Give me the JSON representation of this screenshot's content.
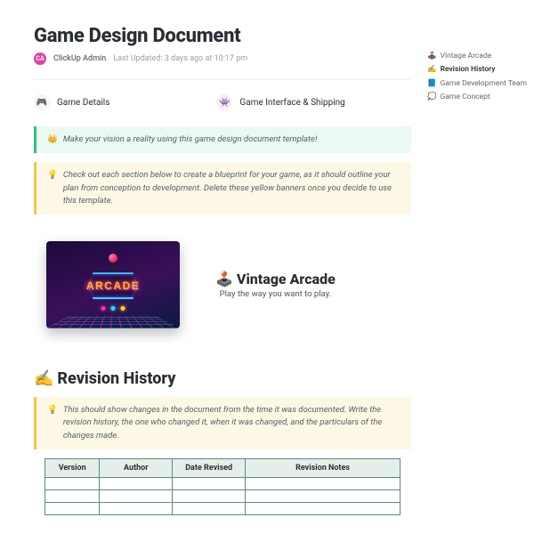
{
  "title": "Game Design Document",
  "author": {
    "initials": "CA",
    "name": "ClickUp Admin"
  },
  "updated": "Last Updated: 3 days ago at 10:17 pm",
  "quicklinks": [
    {
      "icon": "🎮",
      "label": "Game Details"
    },
    {
      "icon": "👾",
      "label": "Game Interface & Shipping"
    }
  ],
  "banners": {
    "green": {
      "emoji": "👑",
      "text": "Make your vision a reality using this game design document template!"
    },
    "yellow_intro": {
      "emoji": "💡",
      "text": "Check out each section below to create a blueprint for your game, as it should outline your plan from conception to development. Delete these yellow banners once you decide to use this template."
    },
    "yellow_revision": {
      "emoji": "💡",
      "text": "This should show changes in the document from the time it was documented. Write the revision history, the one who changed it, when it was changed, and the particulars of the changes made."
    }
  },
  "vintage": {
    "image_word": "ARCADE",
    "title": "Vintage Arcade",
    "icon": "🕹️",
    "subtitle": "Play the way you want to play."
  },
  "sections": {
    "revision": {
      "icon": "✍️",
      "title": "Revision History"
    }
  },
  "revision_table": {
    "headers": [
      "Version",
      "Author",
      "Date Revised",
      "Revision Notes"
    ],
    "rows": [
      [
        "",
        "",
        "",
        ""
      ],
      [
        "",
        "",
        "",
        ""
      ],
      [
        "",
        "",
        "",
        ""
      ]
    ]
  },
  "toc": [
    {
      "icon": "🕹️",
      "label": "Vintage Arcade"
    },
    {
      "icon": "✍️",
      "label": "Revision History"
    },
    {
      "icon": "📘",
      "label": "Game Development Team"
    },
    {
      "icon": "💭",
      "label": "Game Concept"
    }
  ]
}
